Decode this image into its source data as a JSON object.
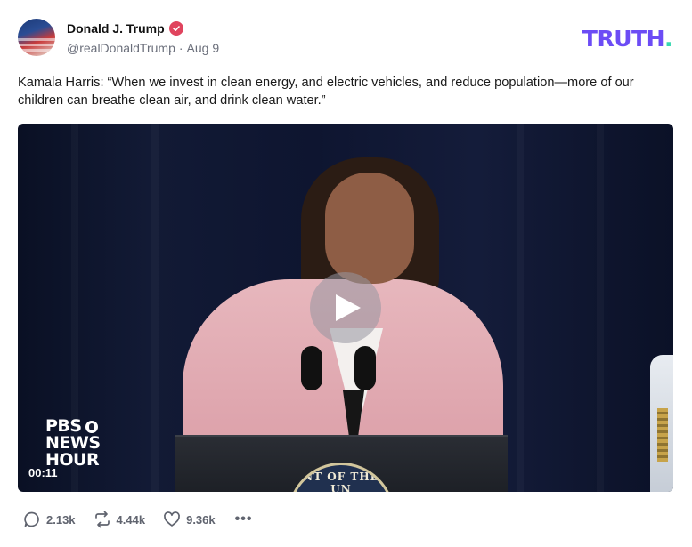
{
  "author": {
    "display_name": "Donald J. Trump",
    "handle": "@realDonaldTrump",
    "separator": "·",
    "date": "Aug 9",
    "verified_color": "#e0445e"
  },
  "brand": {
    "logo_text": "TRUTH",
    "logo_dot": ".",
    "logo_color": "#6c4cf5",
    "dot_color": "#36d8b0"
  },
  "post": {
    "text": "Kamala Harris: “When we invest in clean energy, and electric vehicles, and reduce population—more of our children can breathe clean air, and drink clean water.”"
  },
  "video": {
    "watermark_line1": "PBS",
    "watermark_line2": "NEWS",
    "watermark_line3": "HOUR",
    "timestamp": "00:11",
    "seal_text": "NT OF THE UN"
  },
  "actions": {
    "replies": "2.13k",
    "retruths": "4.44k",
    "likes": "9.36k",
    "more_label": "•••",
    "icons": [
      "comment-icon",
      "retruth-icon",
      "heart-icon",
      "more-icon"
    ]
  }
}
